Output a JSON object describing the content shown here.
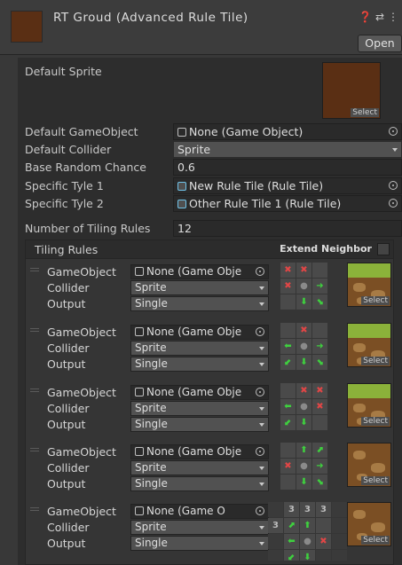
{
  "header": {
    "title": "RT Groud (Advanced Rule Tile)",
    "icons": [
      "help-icon",
      "presets-icon",
      "more-icon"
    ],
    "open_label": "Open"
  },
  "properties": {
    "default_sprite_label": "Default Sprite",
    "sprite_select": "Select",
    "default_gameobject_label": "Default GameObject",
    "default_gameobject_value": "None (Game Object)",
    "default_collider_label": "Default Collider",
    "default_collider_value": "Sprite",
    "base_random_label": "Base Random Chance",
    "base_random_value": "0.6",
    "specific_1_label": "Specific Tyle 1",
    "specific_1_value": "New Rule Tile (Rule Tile)",
    "specific_2_label": "Specific Tyle 2",
    "specific_2_value": "Other Rule Tile 1 (Rule Tile)",
    "num_rules_label": "Number of Tiling Rules",
    "num_rules_value": "12"
  },
  "tiling_rules": {
    "title": "Tiling Rules",
    "extend_neighbor": "Extend Neighbor",
    "gameobject_label": "GameObject",
    "collider_label": "Collider",
    "output_label": "Output",
    "thumb_select": "Select",
    "rules": [
      {
        "gameobject": "None (Game Obje",
        "collider": "Sprite",
        "output": "Single",
        "grid": [
          "x",
          "x",
          "",
          "x",
          "dot",
          "arrow-right",
          "",
          "arrow-down",
          "arrow-down-right"
        ]
      },
      {
        "gameobject": "None (Game Obje",
        "collider": "Sprite",
        "output": "Single",
        "grid": [
          "",
          "x",
          "",
          "arrow-left",
          "dot",
          "arrow-right",
          "arrow-down-left",
          "arrow-down",
          "arrow-down-right"
        ]
      },
      {
        "gameobject": "None (Game Obje",
        "collider": "Sprite",
        "output": "Single",
        "grid": [
          "",
          "x",
          "x",
          "arrow-left",
          "dot",
          "x",
          "arrow-down-left",
          "arrow-down",
          ""
        ]
      },
      {
        "gameobject": "None (Game Obje",
        "collider": "Sprite",
        "output": "Single",
        "grid": [
          "",
          "arrow-up",
          "arrow-up-right",
          "x",
          "dot",
          "arrow-right",
          "",
          "arrow-down",
          "arrow-down-right"
        ]
      },
      {
        "gameobject": "None (Game O",
        "collider": "Sprite",
        "output": "Single",
        "grid5": [
          "",
          "3",
          "3",
          "3",
          "",
          "3",
          "arrow-up-right",
          "arrow-up",
          "",
          "",
          "",
          "arrow-left",
          "dot",
          "x",
          "",
          "",
          "arrow-down-left",
          "arrow-down",
          "",
          ""
        ]
      }
    ]
  },
  "colors": {
    "x": "#e04646",
    "arrow": "#3fd03f",
    "sprite_brown": "#5a2f14"
  }
}
